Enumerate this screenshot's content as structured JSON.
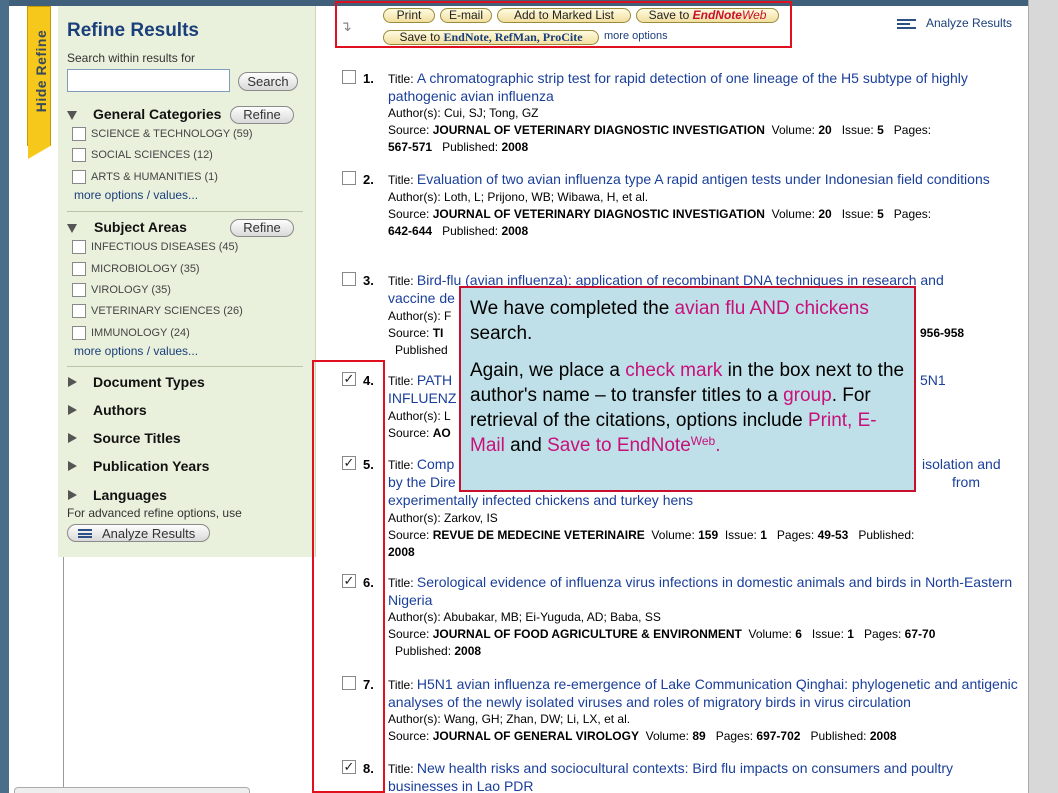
{
  "hide_refine_tab": "Hide Refine",
  "sidebar": {
    "title": "Refine Results",
    "search_hint": "Search within results for",
    "search_value": "",
    "search_button": "Search",
    "general_categories": {
      "label": "General Categories",
      "refine_button": "Refine",
      "items": [
        {
          "label": "SCIENCE & TECHNOLOGY (59)",
          "checked": false
        },
        {
          "label": "SOCIAL SCIENCES (12)",
          "checked": false
        },
        {
          "label": "ARTS & HUMANITIES (1)",
          "checked": false
        }
      ],
      "more": "more options / values..."
    },
    "subject_areas": {
      "label": "Subject Areas",
      "refine_button": "Refine",
      "items": [
        {
          "label": "INFECTIOUS DISEASES (45)",
          "checked": false
        },
        {
          "label": "MICROBIOLOGY (35)",
          "checked": false
        },
        {
          "label": "VIROLOGY (35)",
          "checked": false
        },
        {
          "label": "VETERINARY SCIENCES (26)",
          "checked": false
        },
        {
          "label": "IMMUNOLOGY (24)",
          "checked": false
        }
      ],
      "more": "more options / values..."
    },
    "collapsed_sections": [
      "Document Types",
      "Authors",
      "Source Titles",
      "Publication Years",
      "Languages"
    ],
    "advanced_text": "For advanced refine options, use",
    "analyze_button": "Analyze Results"
  },
  "toolbar": {
    "print": "Print",
    "email": "E-mail",
    "add_marked": "Add to Marked List",
    "save_endnote_web_prefix": "Save to ",
    "save_endnote_web_brand": "EndNote",
    "save_endnote_web_suffix": "Web",
    "save_desktop_prefix": "Save to ",
    "save_desktop_brands": "EndNote, RefMan, ProCite",
    "more_options": "more options",
    "analyze_results": "Analyze Results"
  },
  "results": [
    {
      "num": "1.",
      "checked": false,
      "title_label": "Title: ",
      "title": "A chromatographic strip test for rapid detection of one lineage of the H5 subtype of highly pathogenic avian influenza",
      "authors_label": "Author(s): ",
      "authors": "Cui, SJ; Tong, GZ",
      "source_label": "Source: ",
      "source": "JOURNAL OF VETERINARY DIAGNOSTIC INVESTIGATION",
      "volume_label": "Volume: ",
      "volume": "20",
      "issue_label": "Issue: ",
      "issue": "5",
      "pages_label": "Pages: ",
      "pages": "567-571",
      "published_label": "Published: ",
      "published": "2008"
    },
    {
      "num": "2.",
      "checked": false,
      "title_label": "Title: ",
      "title": "Evaluation of two avian influenza type A rapid antigen tests under Indonesian field conditions",
      "authors_label": "Author(s): ",
      "authors": "Loth, L; Prijono, WB; Wibawa, H, et al.",
      "source_label": "Source: ",
      "source": "JOURNAL OF VETERINARY DIAGNOSTIC INVESTIGATION",
      "volume_label": "Volume: ",
      "volume": "20",
      "issue_label": "Issue: ",
      "issue": "5",
      "pages_label": "Pages: ",
      "pages": "642-644",
      "published_label": "Published: ",
      "published": "2008"
    },
    {
      "num": "3.",
      "checked": false,
      "title_label": "Title: ",
      "title_visible": "Bird-flu (avian influenza): application of recombinant DNA techniques in research and",
      "title_line2": "vaccine de",
      "authors_label": "Author(s): ",
      "authors": "F",
      "source_label": "Source: ",
      "source": "TI",
      "pages_tail": "956-958",
      "published_label": "Published"
    },
    {
      "num": "4.",
      "checked": true,
      "title_label": "Title: ",
      "title_visible": "PATH",
      "title_tail": "5N1",
      "title_line2": "INFLUENZ",
      "authors_label": "Author(s): ",
      "authors": "L",
      "source_label": "Source: ",
      "source": "AO"
    },
    {
      "num": "5.",
      "checked": true,
      "title_label": "Title: ",
      "title_visible": "Comp",
      "title_tail": "isolation and",
      "title_line2": "by the Dire",
      "title_line2_tail": "from",
      "title_line3": "experimentally infected chickens and turkey hens",
      "authors_label": "Author(s): ",
      "authors": "Zarkov, IS",
      "source_label": "Source: ",
      "source": "REVUE DE MEDECINE VETERINAIRE",
      "volume_label": "Volume: ",
      "volume": "159",
      "issue_label": "Issue: ",
      "issue": "1",
      "pages_label": "Pages: ",
      "pages": "49-53",
      "published_label": "Published: ",
      "published": "2008"
    },
    {
      "num": "6.",
      "checked": true,
      "title_label": "Title: ",
      "title": "Serological evidence of influenza virus infections in domestic animals and birds in North-Eastern Nigeria",
      "authors_label": "Author(s): ",
      "authors": "Abubakar, MB; Ei-Yuguda, AD; Baba, SS",
      "source_label": "Source: ",
      "source": "JOURNAL OF FOOD AGRICULTURE & ENVIRONMENT",
      "volume_label": "Volume: ",
      "volume": "6",
      "issue_label": "Issue: ",
      "issue": "1",
      "pages_label": "Pages: ",
      "pages": "67-70",
      "published_label": "Published: ",
      "published": "2008"
    },
    {
      "num": "7.",
      "checked": false,
      "title_label": "Title: ",
      "title": "H5N1 avian influenza re-emergence of Lake Communication Qinghai: phylogenetic and antigenic analyses of the newly isolated viruses and roles of migratory birds in virus circulation",
      "authors_label": "Author(s): ",
      "authors": "Wang, GH; Zhan, DW; Li, LX, et al.",
      "source_label": "Source: ",
      "source": "JOURNAL OF GENERAL VIROLOGY",
      "volume_label": "Volume: ",
      "volume": "89",
      "pages_label": "Pages: ",
      "pages": "697-702",
      "published_label": "Published: ",
      "published": "2008"
    },
    {
      "num": "8.",
      "checked": true,
      "title_label": "Title: ",
      "title": "New health risks and sociocultural contexts: Bird flu impacts on consumers and poultry businesses in Lao PDR"
    }
  ],
  "callout": {
    "p1_a": "We have completed the ",
    "p1_hl": "avian flu AND chickens",
    "p1_b": " search.",
    "p2_a": "Again, we place a ",
    "p2_hl1": "check mark",
    "p2_b": " in the box next to the author's name – to transfer titles to a ",
    "p2_hl2": "group",
    "p2_c": ".  For retrieval of the citations, options include ",
    "p2_hl3": "Print, E-Mail",
    "p2_d": " and ",
    "p2_hl4": "Save to EndNote",
    "p2_sup": "Web",
    "p2_e": "."
  },
  "colors": {
    "highlight_red": "#e0101e",
    "link_blue": "#1a3f9a",
    "callout_bg": "#bfe0e8",
    "callout_highlight": "#c8107a",
    "sidebar_bg": "#e9f0dc",
    "hide_tab_yellow": "#f7c81c"
  },
  "icons": [
    "dotted-arrow-icon",
    "analyze-results-icon",
    "triangle-down-icon",
    "triangle-right-icon",
    "checkbox-icon"
  ]
}
